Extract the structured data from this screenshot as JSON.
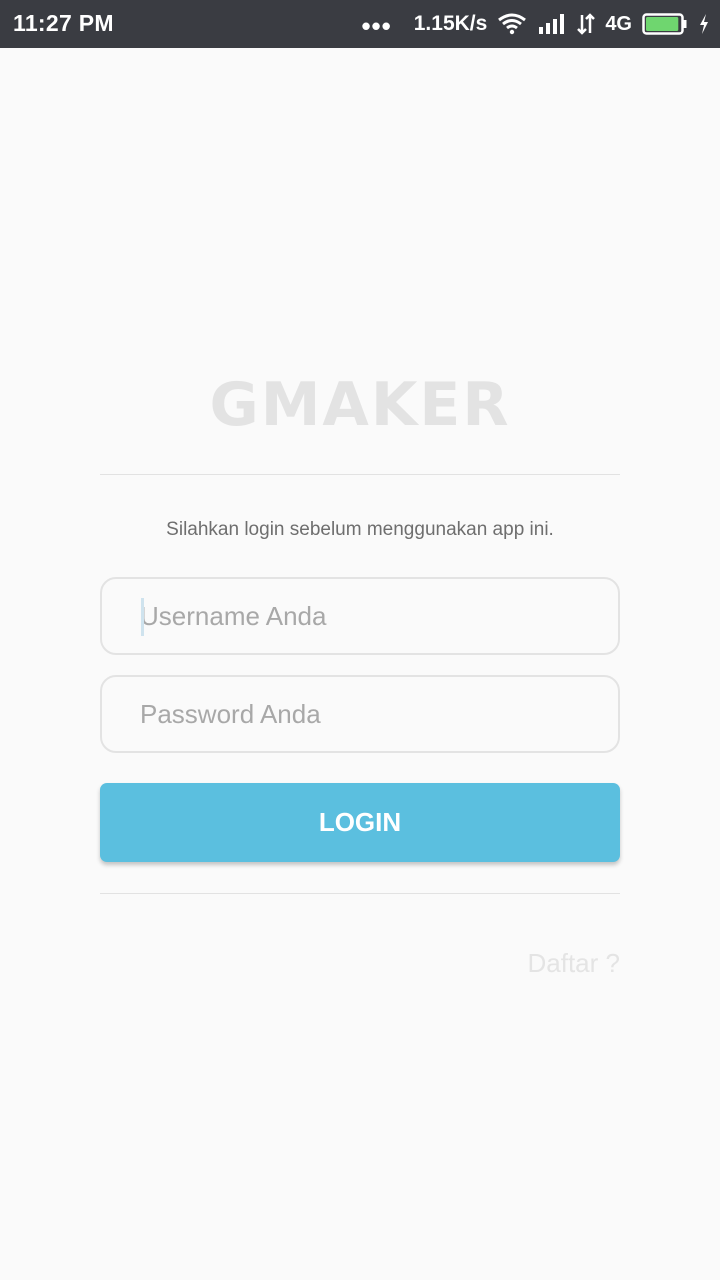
{
  "status_bar": {
    "time": "11:27 PM",
    "dots": "•••",
    "speed": "1.15K/s",
    "network_type": "4G",
    "battery_level": 0.95,
    "icons": [
      "wifi-icon",
      "signal-icon",
      "data-arrows-icon",
      "battery-icon",
      "charging-icon"
    ]
  },
  "login": {
    "app_title": "GMAKER",
    "subtitle": "Silahkan login sebelum menggunakan app ini.",
    "username_placeholder": "Username Anda",
    "username_value": "",
    "password_placeholder": "Password Anda",
    "password_value": "",
    "login_label": "LOGIN",
    "register_label": "Daftar ?"
  },
  "colors": {
    "status_bar_bg": "#3a3c42",
    "accent": "#5bbfdf",
    "battery_fill": "#6fd66f"
  }
}
